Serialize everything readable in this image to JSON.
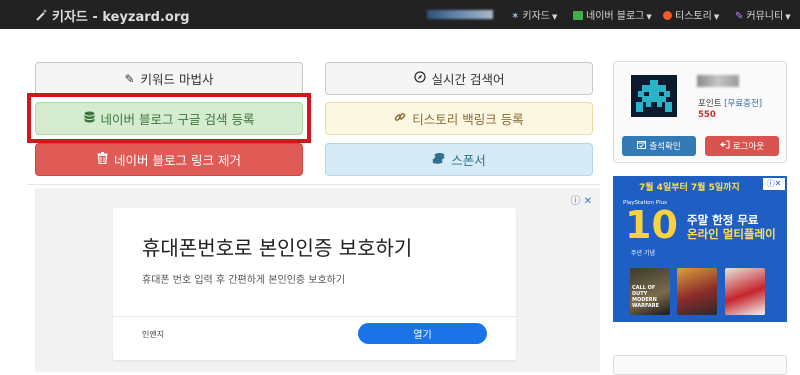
{
  "navbar": {
    "brand": "키자드 - keyzard.org",
    "items": [
      {
        "label": "키자드",
        "icon": "wand-icon"
      },
      {
        "label": "네이버 블로그",
        "icon": "naver-blog-icon"
      },
      {
        "label": "티스토리",
        "icon": "tistory-icon"
      },
      {
        "label": "커뮤니티",
        "icon": "community-icon"
      }
    ]
  },
  "buttons": {
    "keyword_wizard": "키워드 마법사",
    "realtime_search": "실시간 검색어",
    "naver_google_register": "네이버 블로그 구글 검색 등록",
    "tistory_backlink": "티스토리 백링크 등록",
    "naver_link_remove": "네이버 블로그 링크 제거",
    "sponsor": "스폰서"
  },
  "ad": {
    "title": "휴대폰번호로 본인인증 보호하기",
    "description": "휴대폰 번호 입력 후 간편하게 본인인증 보호하기",
    "sponsor": "인앤지",
    "open_button": "열기"
  },
  "user_panel": {
    "points_label": "포인트",
    "charge_link": "[무료충전]",
    "points_value": "550",
    "checkin_button": "출석확인",
    "logout_button": "로그아웃"
  },
  "side_ad": {
    "date_range": "7월 4일부터 7월 5일까지",
    "brand": "PlayStation Plus",
    "number": "10",
    "anniversary": "주년 기념",
    "headline_1": "주말 한정 무료",
    "headline_2": "온라인 멀티플레이",
    "game_1": "CALL OF DUTY MODERN WARFARE"
  },
  "colors": {
    "navbar": "#222222",
    "success": "#d6ecd1",
    "warning": "#fcf7e1",
    "danger": "#e05b55",
    "info": "#d6ebf5",
    "highlight": "#d4161b",
    "ad_blue": "#1f5fc4"
  }
}
